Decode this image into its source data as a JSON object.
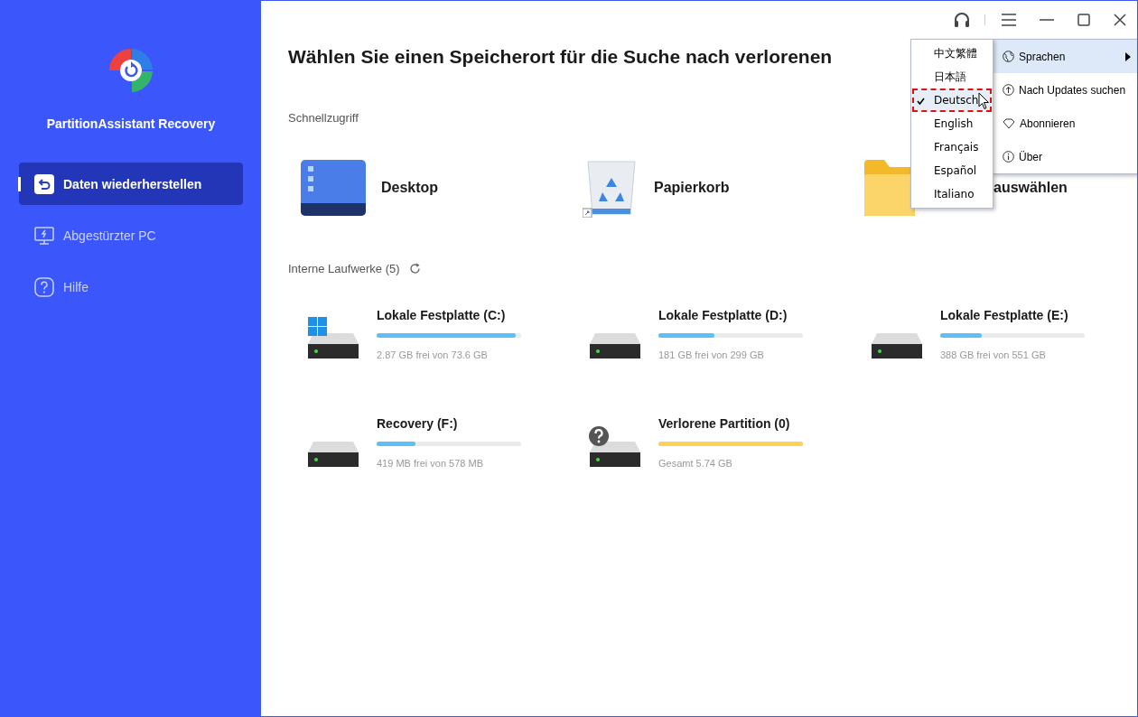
{
  "app": {
    "name": "PartitionAssistant Recovery"
  },
  "sidebar": {
    "items": [
      {
        "label": "Daten wiederherstellen",
        "kind": "restore",
        "selected": true
      },
      {
        "label": "Abgestürzter PC",
        "kind": "crash",
        "selected": false
      },
      {
        "label": "Hilfe",
        "kind": "help",
        "selected": false
      }
    ]
  },
  "title": "Wählen Sie einen Speicherort für die Suche nach verlorenen",
  "quick_access": {
    "heading": "Schnellzugriff",
    "items": [
      {
        "label": "Desktop",
        "kind": "desktop"
      },
      {
        "label": "Papierkorb",
        "kind": "bin"
      },
      {
        "label": "auswählen",
        "kind": "folder"
      }
    ]
  },
  "drives": {
    "heading": "Interne Laufwerke (5)",
    "items": [
      {
        "name": "Lokale Festplatte (C:)",
        "kind": "system",
        "level": 0.96,
        "info": "2.87 GB frei von 73.6 GB"
      },
      {
        "name": "Lokale Festplatte (D:)",
        "kind": "disk",
        "level": 0.39,
        "info": "181 GB frei von 299 GB"
      },
      {
        "name": "Lokale Festplatte (E:)",
        "kind": "disk",
        "level": 0.29,
        "info": "388 GB frei von 551 GB"
      },
      {
        "name": "Recovery (F:)",
        "kind": "disk",
        "level": 0.27,
        "info": "419 MB frei von 578 MB"
      },
      {
        "name": "Verlorene Partition (0)",
        "kind": "lost",
        "level": 1,
        "info": "Gesamt 5.74 GB"
      }
    ]
  },
  "menu": {
    "items": [
      {
        "label": "Sprachen",
        "kind": "languages",
        "selected": true,
        "submenu": true
      },
      {
        "label": "Nach Updates suchen",
        "kind": "updates",
        "selected": false,
        "submenu": false
      },
      {
        "label": "Abonnieren",
        "kind": "subscribe",
        "selected": false,
        "submenu": false
      },
      {
        "label": "Über",
        "kind": "about",
        "selected": false,
        "submenu": false
      }
    ]
  },
  "language_menu": {
    "items": [
      {
        "label": "中文繁體",
        "selected": false
      },
      {
        "label": "日本語",
        "selected": false
      },
      {
        "label": "Deutsch",
        "selected": true
      },
      {
        "label": "English",
        "selected": false
      },
      {
        "label": "Français",
        "selected": false
      },
      {
        "label": "Español",
        "selected": false
      },
      {
        "label": "Italiano",
        "selected": false
      }
    ]
  }
}
